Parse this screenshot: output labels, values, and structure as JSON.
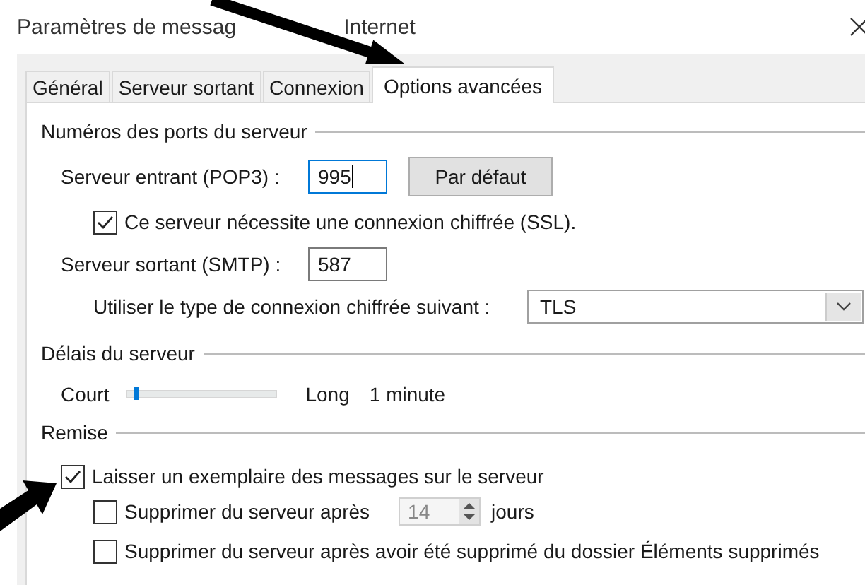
{
  "window": {
    "title_parts": [
      "Paramètres de messag",
      "Internet"
    ]
  },
  "tabs": [
    {
      "label": "Général",
      "selected": false
    },
    {
      "label": "Serveur sortant",
      "selected": false
    },
    {
      "label": "Connexion",
      "selected": false
    },
    {
      "label": "Options avancées",
      "selected": true
    }
  ],
  "ports": {
    "heading": "Numéros des ports du serveur",
    "incoming": {
      "label": "Serveur entrant (POP3) :",
      "value": "995"
    },
    "default_button": "Par défaut",
    "ssl": {
      "label": "Ce serveur nécessite une connexion chiffrée (SSL).",
      "checked": true
    },
    "outgoing": {
      "label": "Serveur sortant (SMTP) :",
      "value": "587"
    },
    "encryption": {
      "label": "Utiliser le type de connexion chiffrée suivant :",
      "value": "TLS"
    }
  },
  "timeouts": {
    "heading": "Délais du serveur",
    "min_label": "Court",
    "max_label": "Long",
    "value_text": "1 minute",
    "level": 0.05
  },
  "delivery": {
    "heading": "Remise",
    "leave_copy": {
      "label": "Laisser un exemplaire des messages sur le serveur",
      "checked": true
    },
    "remove_after": {
      "label": "Supprimer du serveur après",
      "checked": false,
      "days": "14",
      "unit": "jours",
      "disabled": true
    },
    "remove_deleted": {
      "label": "Supprimer du serveur après avoir été supprimé du dossier Éléments supprimés",
      "checked": false
    }
  }
}
